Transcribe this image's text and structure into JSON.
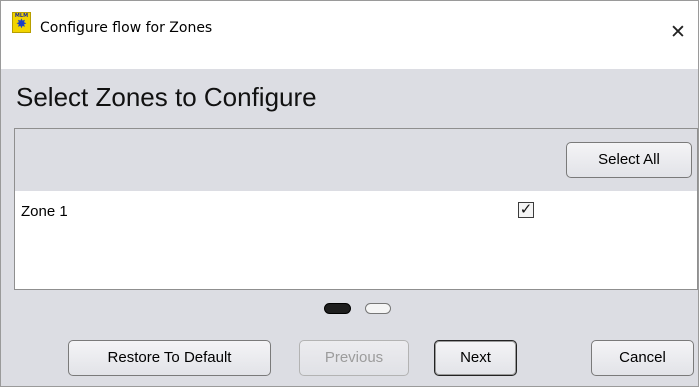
{
  "window": {
    "title": "Configure flow for Zones",
    "icon": "mlm-app-icon",
    "icon_text": "MLM",
    "close_glyph": "✕"
  },
  "page": {
    "heading": "Select Zones to Configure"
  },
  "toolbar": {
    "select_all_label": "Select All"
  },
  "zones": [
    {
      "label": "Zone 1",
      "checked": true
    }
  ],
  "pager": {
    "pages": 2,
    "current": 1
  },
  "buttons": {
    "restore_default": "Restore To Default",
    "previous": "Previous",
    "previous_enabled": false,
    "next": "Next",
    "cancel": "Cancel"
  },
  "colors": {
    "panel_bg": "#dcdde3",
    "list_bg": "#ffffff",
    "disabled_text": "#9c9c9c"
  }
}
